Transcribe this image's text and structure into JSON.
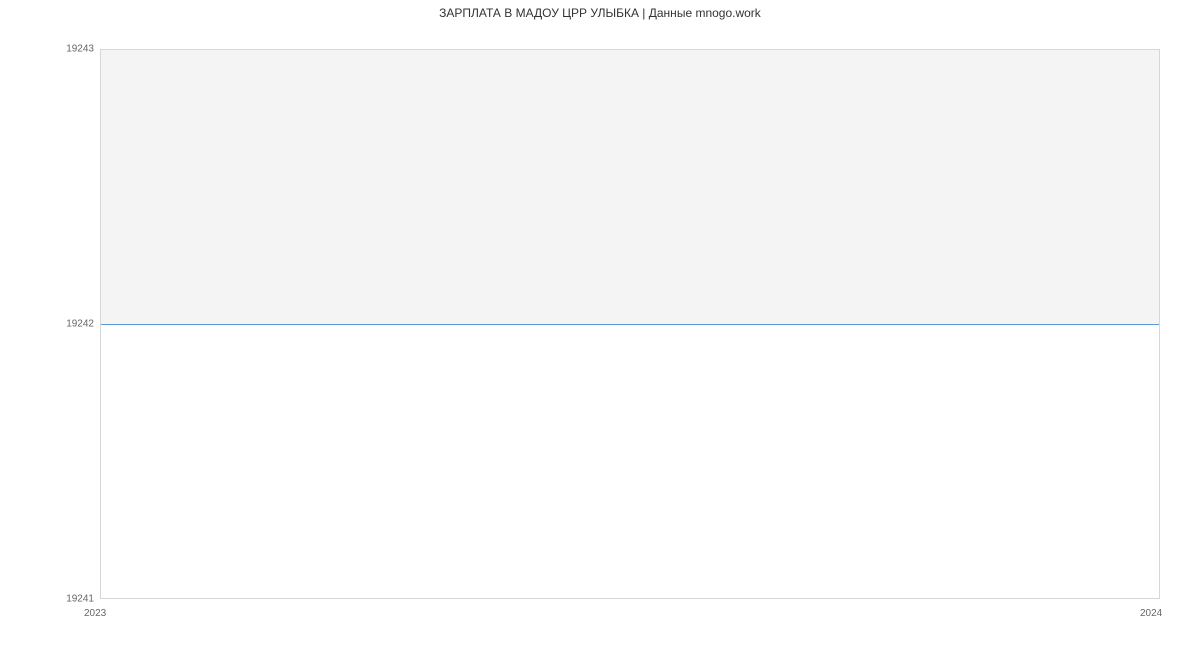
{
  "chart_data": {
    "type": "line",
    "title": "ЗАРПЛАТА В МАДОУ ЦРР УЛЫБКА | Данные mnogo.work",
    "x": [
      2023,
      2024
    ],
    "values": [
      19242,
      19242
    ],
    "xlabel": "",
    "ylabel": "",
    "ylim": [
      19241,
      19243
    ],
    "y_ticks": [
      19241,
      19242,
      19243
    ],
    "x_ticks": [
      2023,
      2024
    ],
    "grid": true,
    "line_color": "#5b9bd5"
  }
}
